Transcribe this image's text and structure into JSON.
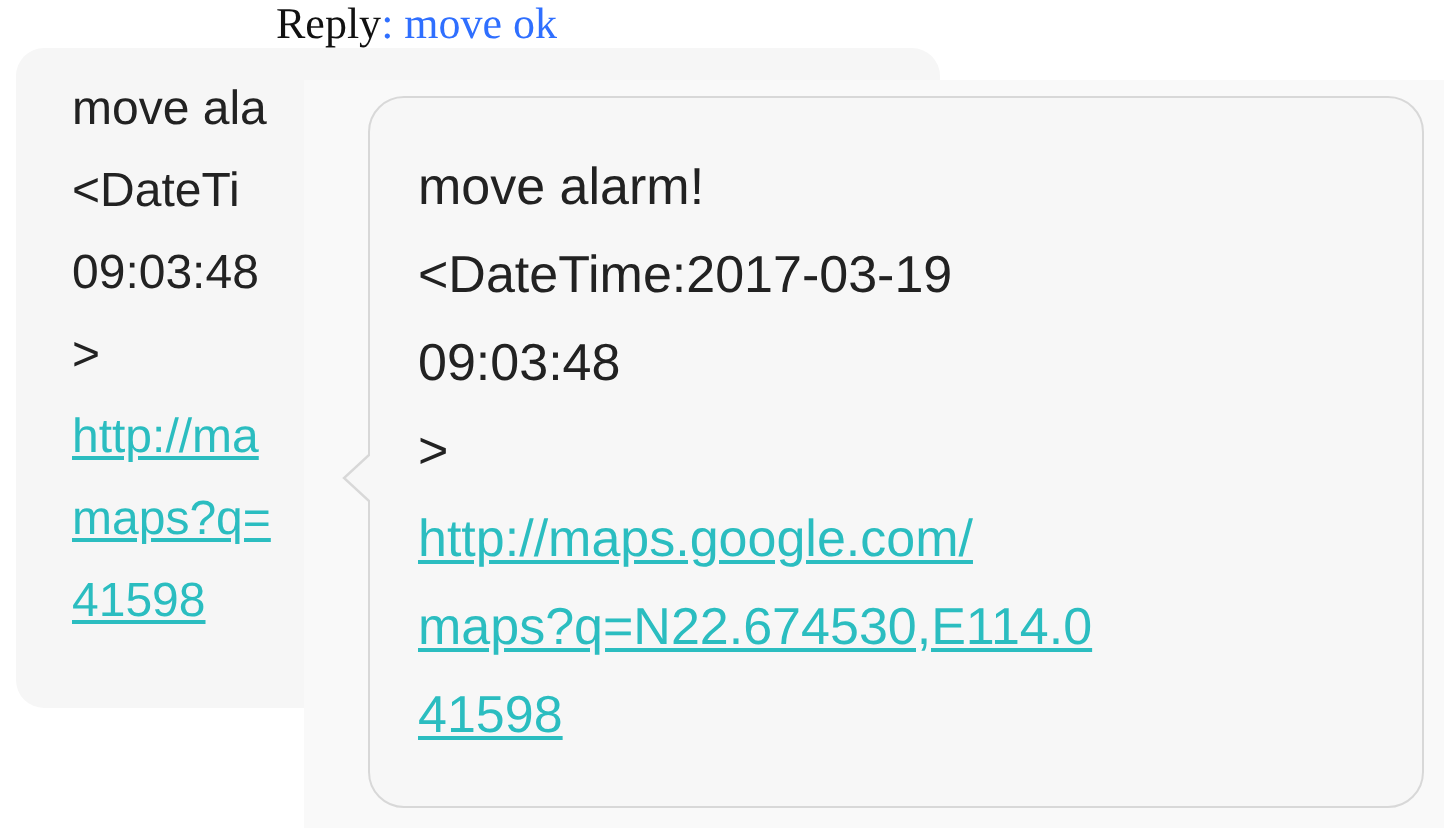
{
  "reply": {
    "label": "Reply",
    "value": ": move ok"
  },
  "messages": [
    {
      "lines": [
        {
          "kind": "text",
          "text": "move ala"
        },
        {
          "kind": "text",
          "text": " <DateTi"
        },
        {
          "kind": "text",
          "text": "09:03:48"
        },
        {
          "kind": "text",
          "text": ">"
        },
        {
          "kind": "link",
          "text": "http://ma"
        },
        {
          "kind": "link",
          "text": "maps?q="
        },
        {
          "kind": "link",
          "text": "41598"
        }
      ]
    },
    {
      "lines": [
        {
          "kind": "text",
          "text": "move alarm!"
        },
        {
          "kind": "text",
          "text": " <DateTime:2017-03-19"
        },
        {
          "kind": "text",
          "text": "09:03:48"
        },
        {
          "kind": "text",
          "text": ">"
        },
        {
          "kind": "link",
          "text": "http://maps.google.com/"
        },
        {
          "kind": "link",
          "text": "maps?q=N22.674530,E114.0"
        },
        {
          "kind": "link",
          "text": "41598"
        }
      ]
    }
  ]
}
